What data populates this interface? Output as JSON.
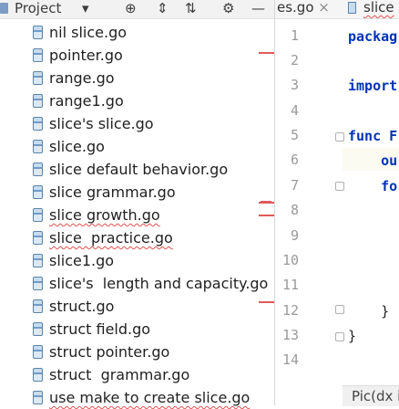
{
  "toolbar": {
    "project_label": "Project",
    "dropdown_glyph": "▾",
    "icons": [
      "target-icon",
      "collapse-icon",
      "expand-icon",
      "gear-icon",
      "hide-icon"
    ],
    "icon_glyphs": [
      "⊕",
      "⇕",
      "⇅",
      "⚙",
      "—"
    ]
  },
  "tree": {
    "files": [
      "nil slice.go",
      "pointer.go",
      "range.go",
      "range1.go",
      "slice's slice.go",
      "slice.go",
      "slice default behavior.go",
      "slice grammar.go",
      "slice growth.go",
      "slice  practice.go",
      "slice1.go",
      "slice's  length and capacity.go",
      "struct.go",
      "struct field.go",
      "struct pointer.go",
      "struct  grammar.go",
      "use make to create slice.go"
    ]
  },
  "editor": {
    "tabs": [
      {
        "label": "es.go",
        "close_glyph": "×"
      },
      {
        "label": "slice"
      }
    ],
    "line_numbers": [
      "1",
      "2",
      "3",
      "4",
      "5",
      "6",
      "7",
      "8",
      "9",
      "10",
      "11",
      "12",
      "13",
      "14"
    ],
    "code_lines": [
      "packag",
      "",
      "import",
      "",
      "func F",
      "    ou",
      "    fo",
      "",
      "",
      "",
      "",
      "    }",
      "}",
      ""
    ]
  },
  "status": {
    "text": "Pic(dx i"
  },
  "colors": {
    "keyword": "#0033b3",
    "error_marker": "#e05a5a",
    "panel_bg": "#f2f2f2"
  }
}
